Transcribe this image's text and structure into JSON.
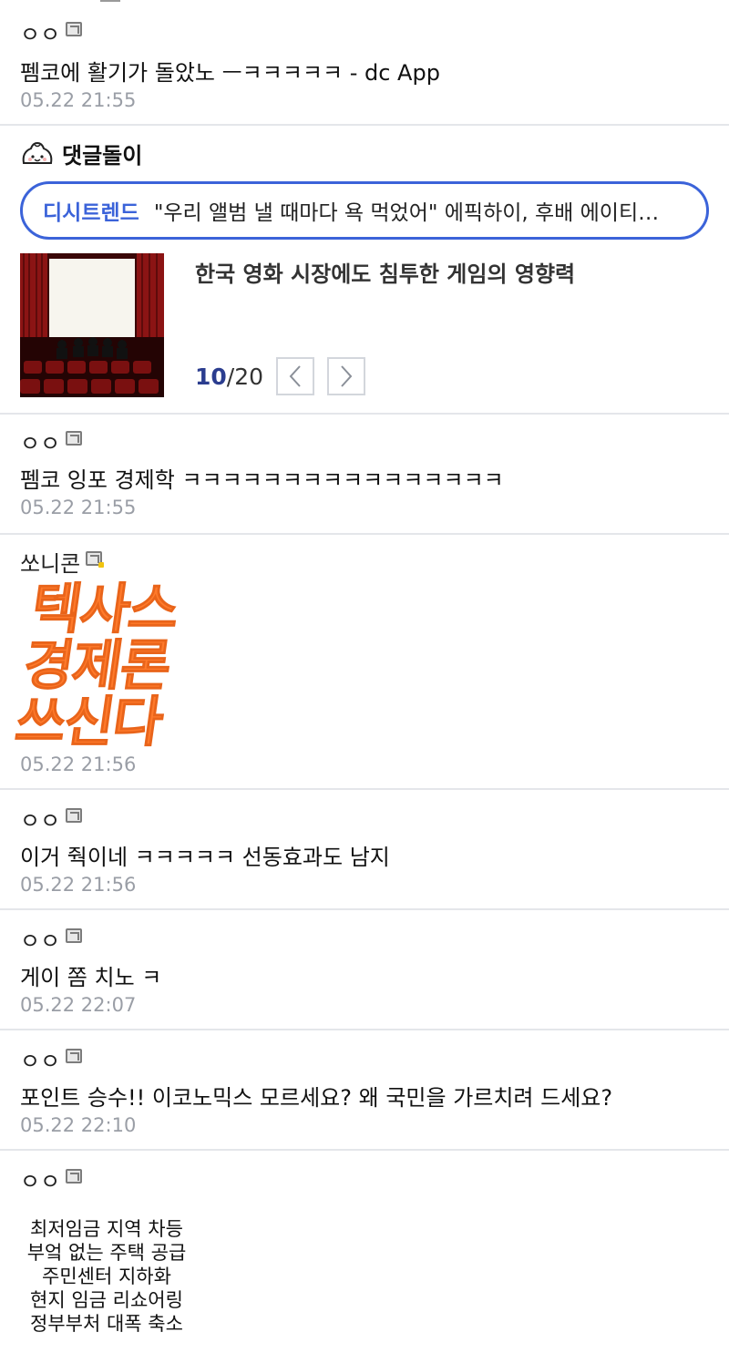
{
  "comments": [
    {
      "nick": "ㅇㅇ",
      "text": "펨코에 활기가 돌았노 ㅡㅋㅋㅋㅋㅋ - dc App",
      "date": "05.22 21:55"
    },
    {
      "nick": "ㅇㅇ",
      "text": "펨코 잉포 경제학 ㅋㅋㅋㅋㅋㅋㅋㅋㅋㅋㅋㅋㅋㅋㅋㅋ",
      "date": "05.22 21:55"
    },
    {
      "nick": "쏘니콘",
      "dccon_lines": [
        "텍사스",
        "경제론",
        "쓰신다"
      ],
      "date": "05.22 21:56"
    },
    {
      "nick": "ㅇㅇ",
      "text": "이거 줙이네 ㅋㅋㅋㅋㅋ 선동효과도 남지",
      "date": "05.22 21:56"
    },
    {
      "nick": "ㅇㅇ",
      "text": "게이 쫌 치노 ㅋ",
      "date": "05.22 22:07"
    },
    {
      "nick": "ㅇㅇ",
      "text": "포인트 승수!! 이코노믹스 모르세요? 왜 국민을 가르치려 드세요?",
      "date": "05.22 22:10"
    },
    {
      "nick": "ㅇㅇ",
      "image_lines": [
        "최저임금 지역 차등",
        "부엌 없는 주택 공급",
        "주민센터 지하화",
        "현지 임금 리쇼어링",
        "정부부처 대폭 축소"
      ]
    }
  ],
  "reply_bot": {
    "title": "댓글돌이",
    "trend_tag": "디시트렌드",
    "trend_text": "\"우리 앨범 낼 때마다 욕 먹었어\" 에픽하이, 후배 에이티…",
    "news_title": "한국 영화 시장에도 침투한 게임의 영향력",
    "page_current": "10",
    "page_total": "/20"
  },
  "icons": {
    "gallery": "gallery-icon",
    "bot": "dumpling-bot-icon",
    "prev": "chevron-left-icon",
    "next": "chevron-right-icon"
  },
  "colors": {
    "accent": "#3b63d9",
    "date": "#9a9ea6",
    "dccon": "#ff7a2b"
  }
}
